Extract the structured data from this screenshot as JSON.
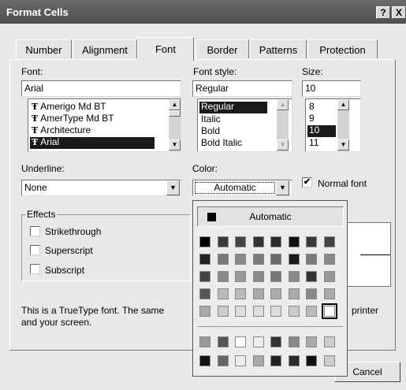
{
  "window": {
    "title": "Format Cells",
    "help_label": "?",
    "close_label": "X"
  },
  "tabs": [
    {
      "label": "Number"
    },
    {
      "label": "Alignment"
    },
    {
      "label": "Font"
    },
    {
      "label": "Border"
    },
    {
      "label": "Patterns"
    },
    {
      "label": "Protection"
    }
  ],
  "font": {
    "label": "Font:",
    "value": "Arial",
    "list": [
      {
        "icon": "truetype-icon",
        "label": "Amerigo Md BT"
      },
      {
        "icon": "truetype-icon",
        "label": "AmerType Md BT"
      },
      {
        "icon": "truetype-icon",
        "label": "Architecture"
      },
      {
        "icon": "truetype-icon",
        "label": "Arial"
      }
    ]
  },
  "font_style": {
    "label": "Font style:",
    "value": "Regular",
    "list": [
      "Regular",
      "Italic",
      "Bold",
      "Bold Italic"
    ]
  },
  "size": {
    "label": "Size:",
    "value": "10",
    "list": [
      "8",
      "9",
      "10",
      "11"
    ]
  },
  "underline": {
    "label": "Underline:",
    "value": "None"
  },
  "color": {
    "label": "Color:",
    "value": "Automatic"
  },
  "normal_font": {
    "label": "Normal font",
    "checked": true,
    "check_glyph": "✔"
  },
  "effects": {
    "title": "Effects",
    "items": [
      {
        "label": "Strikethrough",
        "checked": false
      },
      {
        "label": "Superscript",
        "checked": false
      },
      {
        "label": "Subscript",
        "checked": false
      }
    ]
  },
  "info_text": {
    "line1_left": "This is a TrueType font.  The same",
    "line1_right": "printer",
    "line2": "and your screen."
  },
  "buttons": {
    "cancel": "Cancel"
  },
  "color_popup": {
    "automatic_label": "Automatic",
    "rows": [
      [
        "#000000",
        "#3a3a3a",
        "#444444",
        "#333333",
        "#2a2a2a",
        "#111111",
        "#3a3a3a",
        "#444444"
      ],
      [
        "#222222",
        "#777777",
        "#888888",
        "#7a7a7a",
        "#6a6a6a",
        "#1a1a1a",
        "#7a7a7a",
        "#888888"
      ],
      [
        "#444444",
        "#8a8a8a",
        "#999999",
        "#8a8a8a",
        "#777777",
        "#8a8a8a",
        "#333333",
        "#999999"
      ],
      [
        "#555555",
        "#bbbbbb",
        "#bbbbbb",
        "#aaaaaa",
        "#aaaaaa",
        "#aaaaaa",
        "#8a8a8a",
        "#aaaaaa"
      ],
      [
        "#a8a8a8",
        "#cccccc",
        "#dddddd",
        "#dddddd",
        "#dddddd",
        "#cccccc",
        "#bbbbbb",
        "#ffffff"
      ],
      [
        "#999999",
        "#555555",
        "#ffffff",
        "#eeeeee",
        "#333333",
        "#888888",
        "#aaaaaa",
        "#cccccc"
      ],
      [
        "#111111",
        "#666666",
        "#eeeeee",
        "#aaaaaa",
        "#222222",
        "#2a2a2a",
        "#111111",
        "#cccccc"
      ]
    ],
    "selected": [
      4,
      7
    ]
  }
}
